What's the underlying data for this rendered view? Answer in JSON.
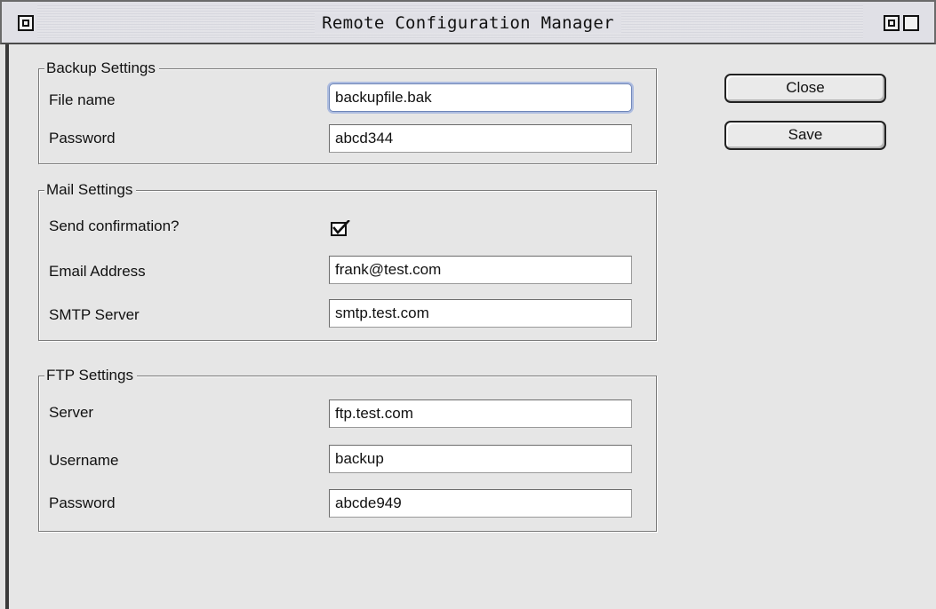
{
  "window": {
    "title": "Remote Configuration Manager"
  },
  "backup": {
    "group_title": "Backup Settings",
    "file_name_label": "File name",
    "file_name_value": "backupfile.bak",
    "password_label": "Password",
    "password_value": "abcd344"
  },
  "mail": {
    "group_title": "Mail Settings",
    "send_confirmation_label": "Send confirmation?",
    "send_confirmation_checked": true,
    "email_label": "Email Address",
    "email_value": "frank@test.com",
    "smtp_label": "SMTP Server",
    "smtp_value": "smtp.test.com"
  },
  "ftp": {
    "group_title": "FTP Settings",
    "server_label": "Server",
    "server_value": "ftp.test.com",
    "username_label": "Username",
    "username_value": "backup",
    "password_label": "Password",
    "password_value": "abcde949"
  },
  "actions": {
    "close_label": "Close",
    "save_label": "Save"
  },
  "icons": {
    "window_close": "close-box-icon",
    "window_zoom": "zoom-box-icon",
    "window_collapse": "collapse-box-icon",
    "checkbox": "checkmark-icon"
  }
}
